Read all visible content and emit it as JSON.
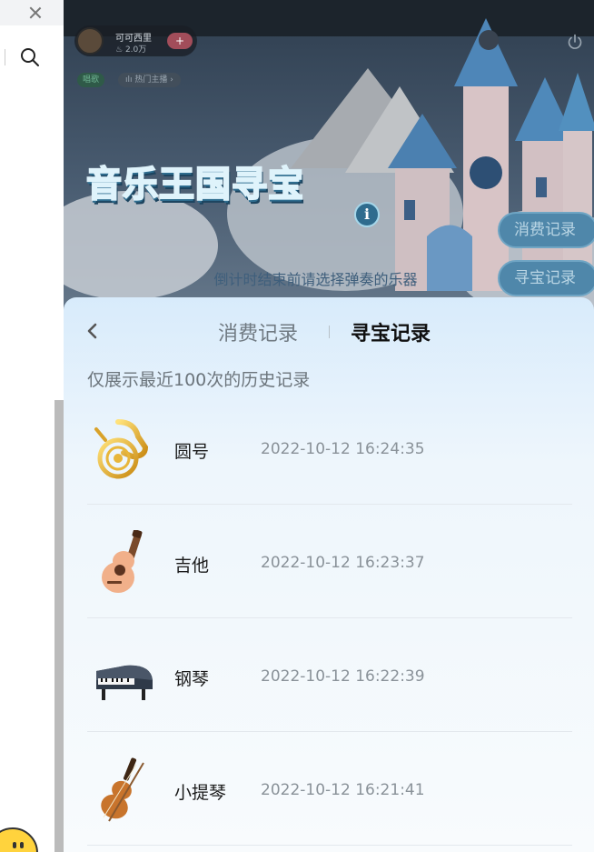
{
  "game": {
    "user": {
      "name": "可可西里",
      "heat": "2.0万",
      "follow": "+"
    },
    "tag": "唱歌",
    "hot": "热门主播 ›",
    "title": "音乐王国寻宝",
    "info": "i",
    "side_buttons": [
      "消费记录",
      "寻宝记录"
    ],
    "prompt": "倒计时结束前请选择弹奏的乐器"
  },
  "sheet": {
    "tabs": [
      {
        "label": "消费记录",
        "active": false
      },
      {
        "label": "寻宝记录",
        "active": true
      }
    ],
    "note": "仅展示最近100次的历史记录",
    "records": [
      {
        "instrument": "圆号",
        "time": "2022-10-12 16:24:35",
        "icon": "french-horn-icon"
      },
      {
        "instrument": "吉他",
        "time": "2022-10-12 16:23:37",
        "icon": "guitar-icon"
      },
      {
        "instrument": "钢琴",
        "time": "2022-10-12 16:22:39",
        "icon": "piano-icon"
      },
      {
        "instrument": "小提琴",
        "time": "2022-10-12 16:21:41",
        "icon": "violin-icon"
      }
    ]
  },
  "colors": {
    "accent_blue": "#4f87aa",
    "sheet_top": "#d8ebfb",
    "text_dark": "#111111",
    "text_muted": "#8a9299"
  }
}
